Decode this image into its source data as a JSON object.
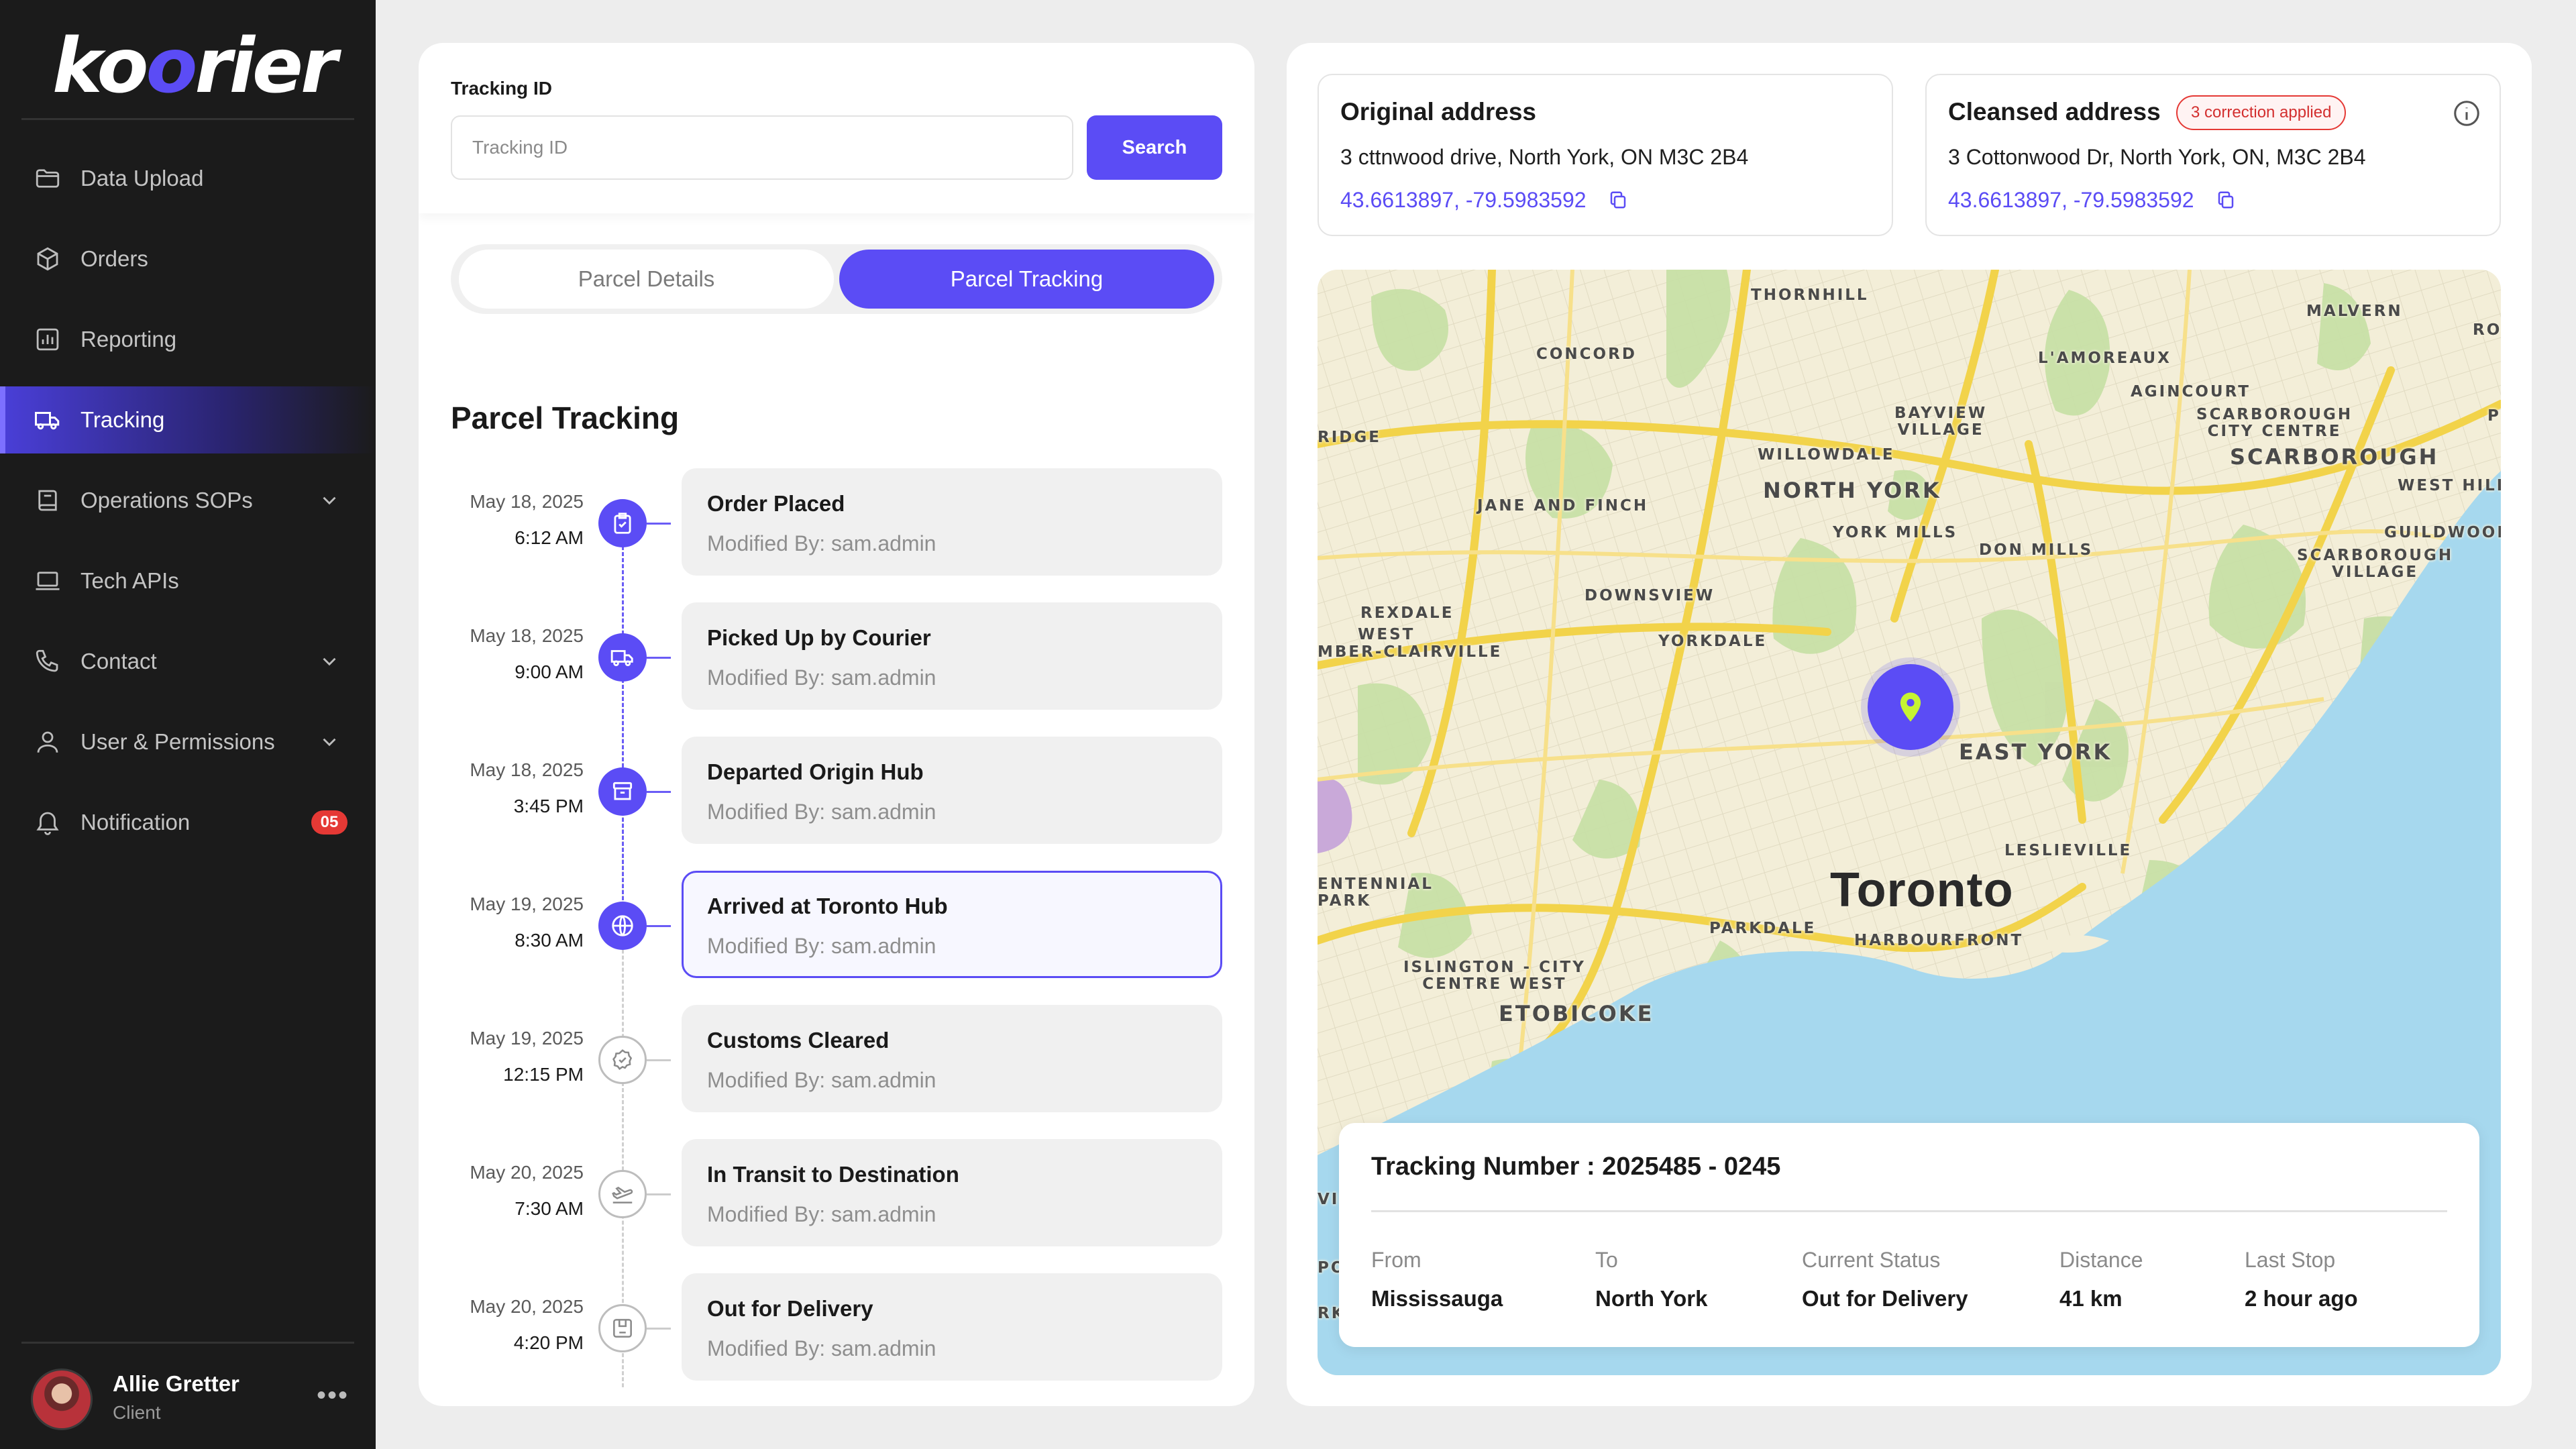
{
  "brand": {
    "logo_a": "k",
    "logo_b": "o",
    "logo_c": "o",
    "logo_d": "rier",
    "accent": "#5B4CF5"
  },
  "sidebar": {
    "items": [
      {
        "label": "Data Upload",
        "icon": "folder-icon"
      },
      {
        "label": "Orders",
        "icon": "box-icon"
      },
      {
        "label": "Reporting",
        "icon": "chart-icon"
      },
      {
        "label": "Tracking",
        "icon": "truck-icon",
        "active": true
      },
      {
        "label": "Operations SOPs",
        "icon": "book-icon",
        "expandable": true
      },
      {
        "label": "Tech APIs",
        "icon": "laptop-icon"
      },
      {
        "label": "Contact",
        "icon": "phone-icon",
        "expandable": true
      },
      {
        "label": "User & Permissions",
        "icon": "user-icon",
        "expandable": true
      },
      {
        "label": "Notification",
        "icon": "bell-icon",
        "badge": "05"
      }
    ],
    "user": {
      "name": "Allie Gretter",
      "role": "Client",
      "more": "•••"
    }
  },
  "search": {
    "label": "Tracking ID",
    "placeholder": "Tracking ID",
    "button": "Search"
  },
  "tabs": {
    "details": "Parcel Details",
    "tracking": "Parcel Tracking"
  },
  "tracking_section": {
    "title": "Parcel Tracking",
    "events": [
      {
        "date": "May 18, 2025",
        "time": "6:12 AM",
        "title": "Order Placed",
        "modified": "Modified By: sam.admin",
        "status": "done"
      },
      {
        "date": "May 18, 2025",
        "time": "9:00 AM",
        "title": "Picked Up by Courier",
        "modified": "Modified By: sam.admin",
        "status": "done"
      },
      {
        "date": "May 18, 2025",
        "time": "3:45 PM",
        "title": "Departed Origin Hub",
        "modified": "Modified By: sam.admin",
        "status": "done"
      },
      {
        "date": "May 19, 2025",
        "time": "8:30 AM",
        "title": "Arrived at Toronto Hub",
        "modified": "Modified By: sam.admin",
        "status": "current"
      },
      {
        "date": "May 19, 2025",
        "time": "12:15 PM",
        "title": "Customs Cleared",
        "modified": "Modified By: sam.admin",
        "status": "pending"
      },
      {
        "date": "May 20, 2025",
        "time": "7:30 AM",
        "title": "In Transit to Destination",
        "modified": "Modified By: sam.admin",
        "status": "pending"
      },
      {
        "date": "May 20, 2025",
        "time": "4:20 PM",
        "title": "Out for Delivery",
        "modified": "Modified By: sam.admin",
        "status": "pending"
      }
    ]
  },
  "address": {
    "original": {
      "title": "Original address",
      "line": "3 cttnwood drive, North York, ON M3C 2B4",
      "coords": "43.6613897, -79.5983592"
    },
    "cleansed": {
      "title": "Cleansed address",
      "badge": "3 correction applied",
      "line": "3 Cottonwood Dr, North York, ON, M3C 2B4",
      "coords": "43.6613897, -79.5983592"
    }
  },
  "map": {
    "labels": {
      "thornhill": "THORNHILL",
      "malvern": "MALVERN",
      "rou": "ROU",
      "concord": "CONCORD",
      "lamoureaux": "L'AMOREAUX",
      "agincourt": "AGINCOURT",
      "scar_cc": "SCARBOROUGH\nCITY CENTRE",
      "ridge": "RIDGE",
      "bayview": "BAYVIEW\nVILLAGE",
      "willowdale": "WILLOWDALE",
      "scarborough": "SCARBOROUGH",
      "p": "P",
      "north_york": "NORTH YORK",
      "west_hill": "WEST HILL",
      "jane_finch": "JANE AND FINCH",
      "york_mills": "YORK MILLS",
      "guildwood": "GUILDWOOD",
      "don_mills": "DON MILLS",
      "scar_village": "SCARBOROUGH\nVILLAGE",
      "downsview": "DOWNSVIEW",
      "rexdale": "REXDALE",
      "west": "WEST",
      "humber": "MBER-CLAIRVILLE",
      "yorkdale": "YORKDALE",
      "east_york": "EAST YORK",
      "leslieville": "LESLIEVILLE",
      "centennial": "ENTENNIAL\nPARK",
      "toronto": "Toronto",
      "parkdale": "PARKDALE",
      "harbourfront": "HARBOURFRONT",
      "islington": "ISLINGTON - CITY\nCENTRE WEST",
      "etobicoke": "ETOBICOKE",
      "vil": "VIL",
      "po": "PO",
      "rk": "RK"
    }
  },
  "tracking_card": {
    "title": "Tracking Number : 2025485 - 0245",
    "columns": [
      {
        "label": "From",
        "value": "Mississauga"
      },
      {
        "label": "To",
        "value": "North York"
      },
      {
        "label": "Current Status",
        "value": "Out for Delivery"
      },
      {
        "label": "Distance",
        "value": "41 km"
      },
      {
        "label": "Last Stop",
        "value": "2 hour ago"
      }
    ]
  }
}
